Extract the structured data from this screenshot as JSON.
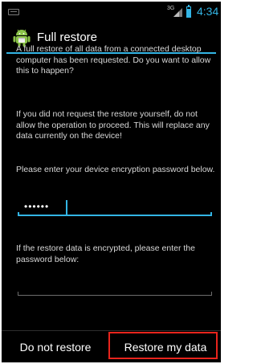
{
  "status_bar": {
    "network_type": "3G",
    "time": "4:34"
  },
  "dialog": {
    "title": "Full restore",
    "message_1": "A full restore of all data from a connected desktop computer has been requested. Do you want to allow this to happen?",
    "message_2": "If you did not request the restore yourself, do not allow the operation to proceed. This will replace any data currently on the device!",
    "password_prompt": "Please enter your device encryption password below.",
    "password_value": "••••••",
    "encryption_prompt": "If the restore data is encrypted, please enter the password below:",
    "encryption_value": ""
  },
  "buttons": {
    "deny_label": "Do not restore",
    "allow_label": "Restore my data"
  },
  "colors": {
    "accent": "#33b5e5",
    "highlight": "#e8241c"
  },
  "icons": {
    "title": "android-robot-icon",
    "keyboard": "keyboard-icon",
    "signal": "signal-icon",
    "battery": "battery-icon"
  }
}
